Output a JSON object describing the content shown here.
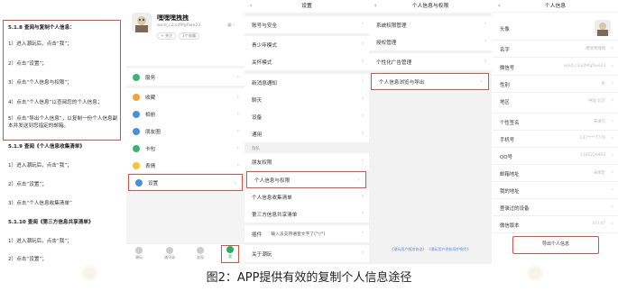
{
  "guide": {
    "s518": "5.1.8 查阅与复制个人信息：",
    "s518_1": "1）进入潮玩后，点击“我”；",
    "s518_2": "2）点击“设置”；",
    "s518_3": "3）点击“个人信息与权限”；",
    "s518_4": "4）点击“个人信息”以查阅您的个人信息；",
    "s518_5": "5）点击“导出个人信息”，以复制一份个人信息副本并发送到您指定的邮箱。",
    "s519": "5.1.9 查阅《个人信息收集清单》",
    "s519_1": "1）进入潮玩后，点击“我”；",
    "s519_2": "2）点击“设置”；",
    "s519_3": "3）点击“个人信息收集清单”",
    "s5110": "5.1.10 查阅《第三方信息共享清单》",
    "s5110_1": "1）进入潮玩后，点击“我”；",
    "s5110_2": "2）点击“设置”；"
  },
  "me": {
    "username": "嘿嘿嘿拽拽",
    "userid": "wxid_c2iojf9fgfiwe23",
    "tag1": "+ 关注",
    "tag2": "1个收藏",
    "menu": [
      "服务",
      "收藏",
      "相册",
      "朋友圈",
      "卡包",
      "表情",
      "设置"
    ],
    "tabs": [
      "潮玩",
      "通讯录",
      "发现",
      "我"
    ]
  },
  "settings": {
    "title": "设置",
    "items_a": [
      "账号与安全",
      "青少年模式",
      "关怀模式"
    ],
    "items_b": [
      "新消息通知",
      "聊天",
      "设备",
      "通用"
    ],
    "section_label": "隐私",
    "items_c": [
      "朋友权限",
      "个人信息与权限",
      "个人信息收集清单",
      "第三方信息共享清单"
    ],
    "plugin_label": "插件",
    "plugin_value": "输入法支持语音文字了(°▽°)",
    "about": "关于潮玩"
  },
  "perm": {
    "title": "个人信息与权限",
    "items_a": [
      "系统权限管理",
      "授权管理",
      "个性化广告管理"
    ],
    "item_export": "个人信息浏览与导出",
    "footnote": "《潮玩用户服务协议》 《潮玩用户隐私保护指引》"
  },
  "info": {
    "title": "个人信息",
    "rows": [
      {
        "k": "头像",
        "v": ""
      },
      {
        "k": "名字",
        "v": "嘿嘿嘿拽拽"
      },
      {
        "k": "微信号",
        "v": "wxid_c2iojf9fgfiwe23"
      },
      {
        "k": "性别",
        "v": "男"
      },
      {
        "k": "地区",
        "v": "中国 北京"
      },
      {
        "k": "个性签名",
        "v": "未填写"
      },
      {
        "k": "手机号",
        "v": "137****7776"
      },
      {
        "k": "QQ号",
        "v": "1102226463"
      },
      {
        "k": "邮箱地址",
        "v": "未绑定"
      },
      {
        "k": "我的地址",
        "v": ""
      },
      {
        "k": "登录过的设备",
        "v": ""
      },
      {
        "k": "微信版本",
        "v": "8.0.47"
      }
    ],
    "export_button": "导出个人信息"
  },
  "caption": "图2：APP提供有效的复制个人信息途径"
}
